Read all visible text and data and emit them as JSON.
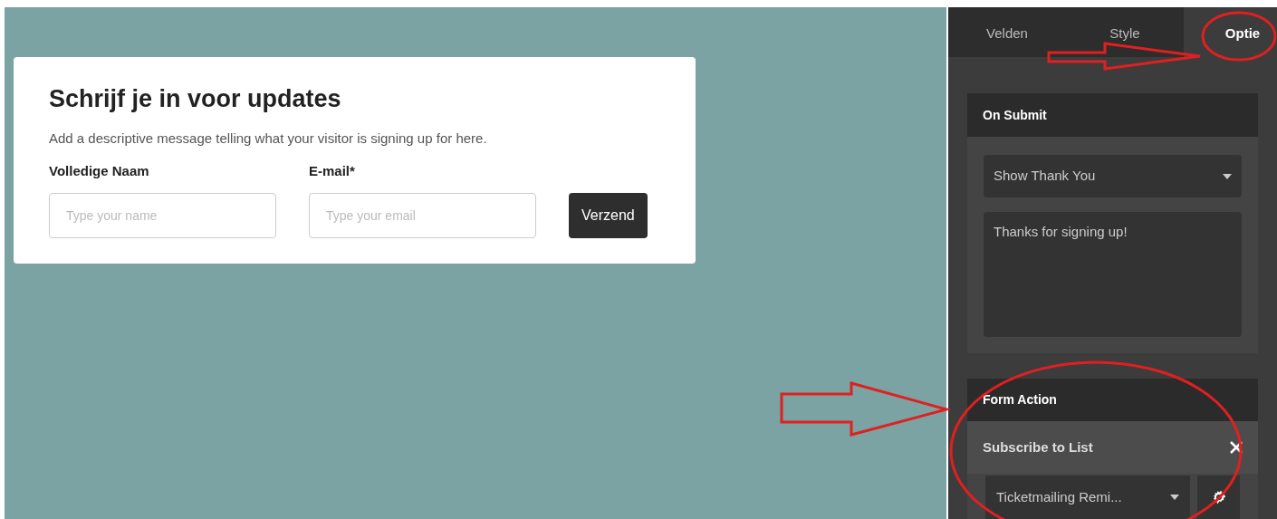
{
  "form_card": {
    "title": "Schrijf je in voor updates",
    "description": "Add a descriptive message telling what your visitor is signing up for here.",
    "fields": [
      {
        "label": "Volledige Naam",
        "placeholder": "Type your name"
      },
      {
        "label": "E-mail*",
        "placeholder": "Type your email"
      }
    ],
    "submit": "Verzend"
  },
  "panel": {
    "tabs": [
      {
        "label": "Velden",
        "selected": false
      },
      {
        "label": "Style",
        "selected": false
      },
      {
        "label": "Optie",
        "selected": true
      }
    ],
    "on_submit": {
      "title": "On Submit",
      "select": "Show Thank You",
      "message": "Thanks for signing up!"
    },
    "form_action": {
      "title": "Form Action",
      "action": "Subscribe to List",
      "list_select": "Ticketmailing Remi..."
    }
  }
}
